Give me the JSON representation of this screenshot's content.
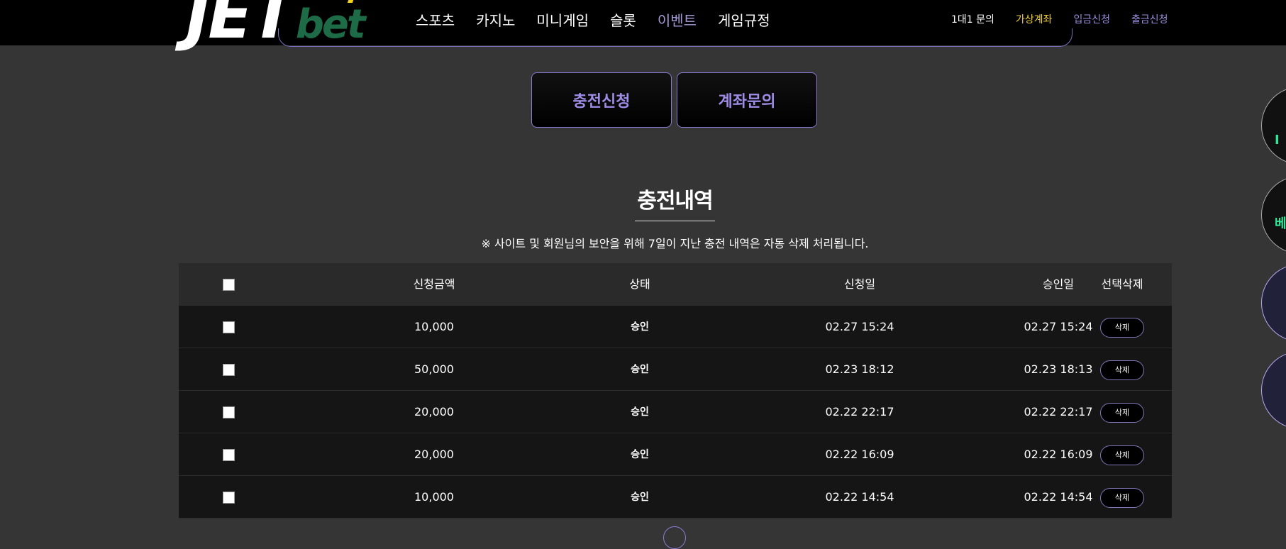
{
  "header": {
    "logo_main": "JET",
    "logo_sub": "bet",
    "nav": [
      "스포츠",
      "카지노",
      "미니게임",
      "슬롯",
      "이벤트",
      "게임규정"
    ],
    "nav_active_index": 4,
    "links": [
      "1대1 문의",
      "가상계좌",
      "입금신청",
      "출금신청"
    ]
  },
  "tabs": {
    "charge_request": "충전신청",
    "account_inquiry": "계좌문의"
  },
  "section": {
    "title": "충전내역",
    "notice": "※ 사이트 및 회원님의 보안을 위해 7일이 지난 충전 내역은 자동 삭제 처리됩니다."
  },
  "table": {
    "headers": {
      "amount": "신청금액",
      "status": "상태",
      "requested": "신청일",
      "approved": "승인일",
      "delete": "선택삭제"
    },
    "rows": [
      {
        "amount": "10,000",
        "status": "승인",
        "requested": "02.27 15:24",
        "approved": "02.27 15:24",
        "delete_label": "삭제"
      },
      {
        "amount": "50,000",
        "status": "승인",
        "requested": "02.23 18:12",
        "approved": "02.23 18:13",
        "delete_label": "삭제"
      },
      {
        "amount": "20,000",
        "status": "승인",
        "requested": "02.22 22:17",
        "approved": "02.22 22:17",
        "delete_label": "삭제"
      },
      {
        "amount": "20,000",
        "status": "승인",
        "requested": "02.22 16:09",
        "approved": "02.22 16:09",
        "delete_label": "삭제"
      },
      {
        "amount": "10,000",
        "status": "승인",
        "requested": "02.22 14:54",
        "approved": "02.22 14:54",
        "delete_label": "삭제"
      }
    ]
  },
  "side_widgets": {
    "glyph_1": "I",
    "glyph_2": "베"
  },
  "colors": {
    "background": "#353535",
    "header_bg": "#000000",
    "accent_purple": "#9e8de6",
    "accent_yellow": "#f4d238",
    "logo_green": "#1d6b47"
  }
}
